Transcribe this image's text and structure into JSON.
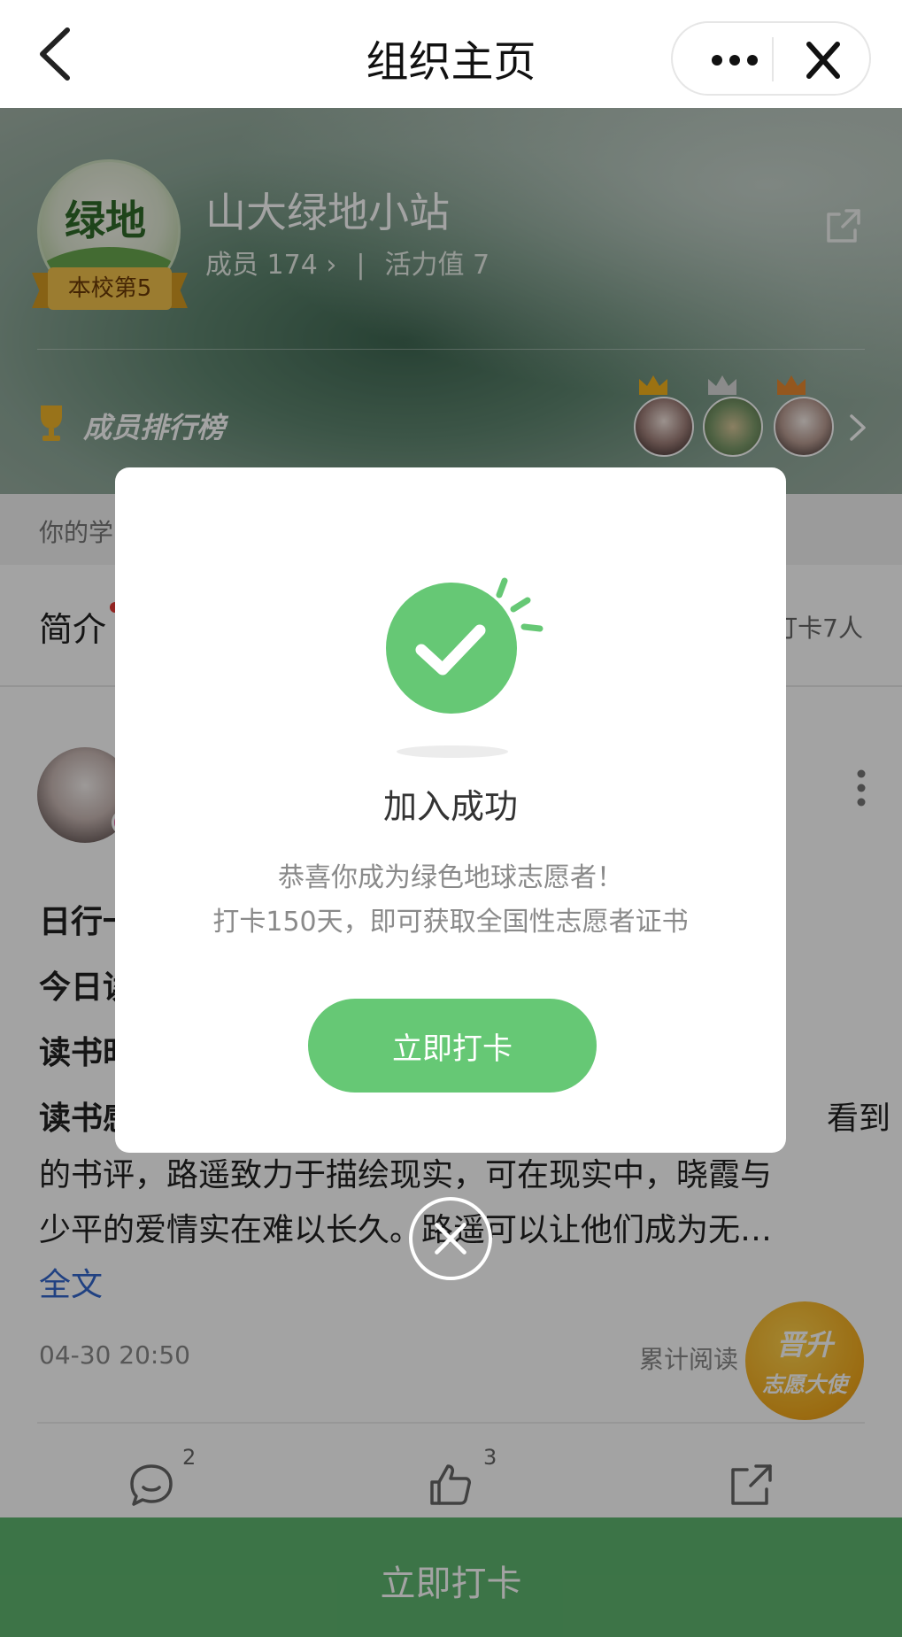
{
  "nav": {
    "title": "组织主页"
  },
  "org": {
    "name": "山大绿地小站",
    "rank_badge": "本校第5",
    "members_label": "成员 174",
    "vitality_label": "活力值 7",
    "separator": "|",
    "ranking_label": "成员排行榜",
    "avatar_lettering": "绿地"
  },
  "school_strip": {
    "text": "你的学"
  },
  "intro": {
    "label": "简介",
    "right_text": "打卡7人"
  },
  "post": {
    "lines": [
      {
        "text": "日行一",
        "bold": true
      },
      {
        "text": "今日读",
        "bold": true
      },
      {
        "text": "读书时",
        "bold": true
      },
      {
        "text": "读书感",
        "bold": true,
        "tail": "看到"
      },
      {
        "text": "的书评，路遥致力于描绘现实，可在现实中，晓霞与",
        "bold": false
      },
      {
        "text": "少平的爱情实在难以长久。路遥可以让他们成为无…",
        "bold": false
      }
    ],
    "more_link": "全文",
    "time": "04-30 20:50",
    "reads": "累计阅读",
    "comment_count": "2",
    "like_count": "3"
  },
  "promote_badge": {
    "line1": "晋升",
    "line2": "志愿大使"
  },
  "bottom_bar": {
    "label": "立即打卡"
  },
  "modal": {
    "title": "加入成功",
    "desc_line1": "恭喜你成为绿色地球志愿者！",
    "desc_line2": "打卡150天，即可获取全国性志愿者证书",
    "button": "立即打卡"
  },
  "icons": {
    "back": "chevron-left-icon",
    "more": "more-dots-icon",
    "close": "close-icon",
    "share": "share-icon",
    "trophy": "trophy-icon",
    "check": "check-circle-icon",
    "comment": "comment-icon",
    "like": "thumbs-up-icon"
  },
  "colors": {
    "primary_green": "#66c875",
    "bottom_bar_green": "#5fb66f",
    "badge_gold": "#f3c34b",
    "link_blue": "#3366cc"
  }
}
